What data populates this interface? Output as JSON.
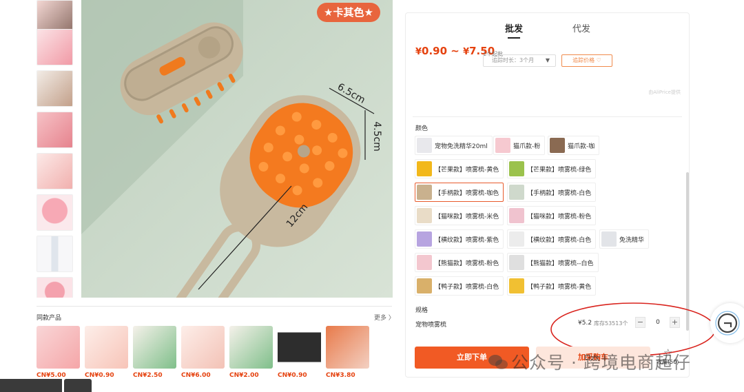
{
  "product": {
    "color_tag": "★卡其色★",
    "dimensions": [
      "6.5cm",
      "4.5cm",
      "12cm"
    ]
  },
  "similar": {
    "title": "同款产品",
    "more": "更多 〉",
    "items": [
      {
        "price": "CN¥5.00",
        "color": "#f5a6a8"
      },
      {
        "price": "CN¥0.90",
        "color": "#f7c4b8"
      },
      {
        "price": "CN¥2.50",
        "color": "#cde2c7"
      },
      {
        "price": "CN¥6.00",
        "color": "#f3c2b6"
      },
      {
        "price": "CN¥2.00",
        "color": "#d6e7d0"
      },
      {
        "price": "CN¥0.90",
        "color": "#2d2d2d"
      },
      {
        "price": "CN¥3.80",
        "color": "#e87a4a"
      }
    ]
  },
  "panel": {
    "tab_wholesale": "批发",
    "tab_dropship": "代发",
    "price_min_symbol": "¥",
    "price_min": "0.90",
    "price_sep": " ~ ",
    "price_max_symbol": "¥",
    "price_max": "7.50",
    "min_order": "1个起批",
    "duration": "追踪时长：3个月",
    "track_button": "追踪价格 ♡",
    "provided_by": "由AliPrice提供",
    "color_label": "颜色",
    "spec_label": "规格"
  },
  "options": [
    {
      "label": "宠物免洗精华20ml",
      "swatch": "#e8e8ec"
    },
    {
      "label": "猫爪款-粉",
      "swatch": "#f6c9d0"
    },
    {
      "label": "猫爪款-咖",
      "swatch": "#8a6a52"
    },
    {
      "label": "【芒果款】喷雾梳-黄色",
      "swatch": "#f2b81b"
    },
    {
      "label": "【芒果款】喷雾梳-绿色",
      "swatch": "#9bc24c"
    },
    {
      "label": "【手柄款】喷雾梳-咖色",
      "swatch": "#c9b18e"
    },
    {
      "label": "【手柄款】喷雾梳-白色",
      "swatch": "#cfd9cc"
    },
    {
      "label": "【猫咪款】喷雾梳-米色",
      "swatch": "#e9dcc7"
    },
    {
      "label": "【猫咪款】喷雾梳-粉色",
      "swatch": "#f0c3cf"
    },
    {
      "label": "【横纹款】喷雾梳-紫色",
      "swatch": "#b7a4e0"
    },
    {
      "label": "【横纹款】喷雾梳-白色",
      "swatch": "#ececec"
    },
    {
      "label": "免洗精华",
      "swatch": "#e2e4e8"
    },
    {
      "label": "【熊猫款】喷雾梳-粉色",
      "swatch": "#f3c7cf"
    },
    {
      "label": "【熊猫款】喷雾梳--白色",
      "swatch": "#dfdfdf"
    },
    {
      "label": "【鸭子款】喷雾梳-白色",
      "swatch": "#d9b06a"
    },
    {
      "label": "【鸭子款】喷雾梳-黄色",
      "swatch": "#f1c032"
    }
  ],
  "spec": {
    "name": "宠物喷雾梳",
    "price": "¥5.2",
    "stock": "库存53513个",
    "minus": "−",
    "quantity": "0",
    "plus": "+"
  },
  "actions": {
    "order": "立即下单",
    "cart": "加采购车",
    "favorite_icon": "☆",
    "favorite": "收藏(50)"
  },
  "watermark": "公众号 · 跨境电商超仔",
  "colors": {
    "accent": "#f15a24",
    "price": "#e5420f",
    "annotation_ellipse": "#d9231d"
  }
}
